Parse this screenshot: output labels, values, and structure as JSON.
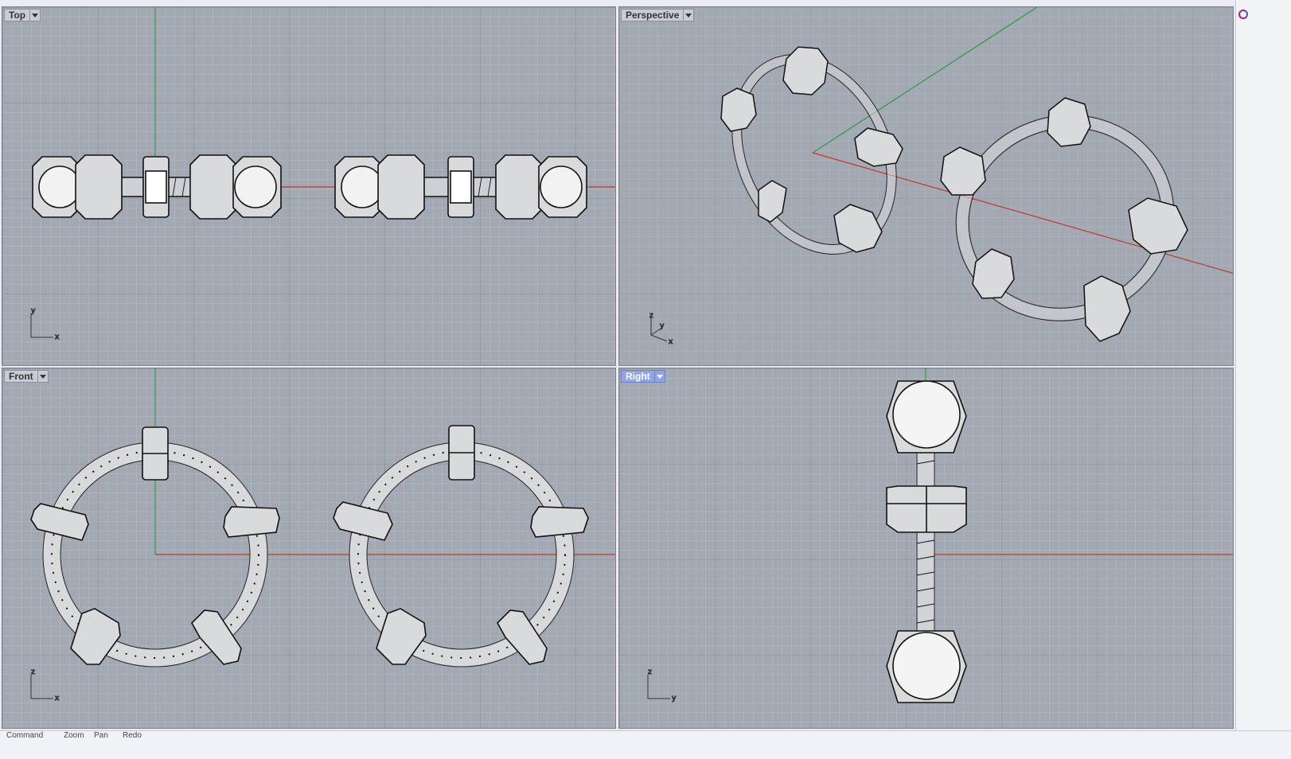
{
  "viewports": [
    {
      "id": "top",
      "label": "Top",
      "active": false,
      "axis_labels": [
        "y",
        "x"
      ]
    },
    {
      "id": "perspective",
      "label": "Perspective",
      "active": false,
      "axis_labels": [
        "z",
        "y",
        "x"
      ]
    },
    {
      "id": "front",
      "label": "Front",
      "active": false,
      "axis_labels": [
        "z",
        "x"
      ]
    },
    {
      "id": "right",
      "label": "Right",
      "active": true,
      "axis_labels": [
        "z",
        "y"
      ]
    }
  ],
  "colors": {
    "background": "#a3a9b2",
    "x_axis": "#c0392b",
    "y_axis": "#2f9a3a",
    "active_tab": "#8fa5e8",
    "object_fill": "#d9dadc"
  },
  "icons": {
    "viewport_menu": "chevron-down-icon",
    "corner": "app-logo-icon"
  },
  "statusbar": {
    "items": [
      "Command",
      "Zoom",
      "Pan",
      "Redo"
    ]
  }
}
